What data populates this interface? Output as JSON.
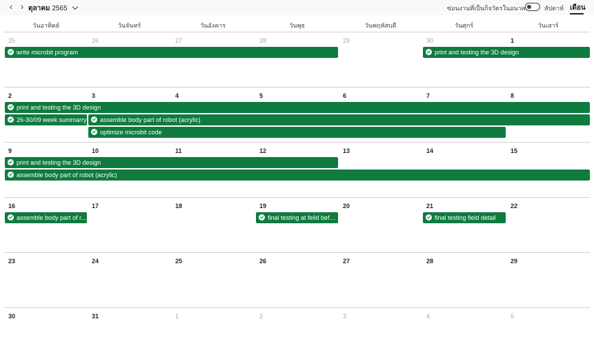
{
  "header": {
    "prev_icon": "chevron-left-icon",
    "next_icon": "chevron-right-icon",
    "month": "ตุลาคม",
    "year": "2565",
    "dropdown_icon": "chevron-down-icon",
    "toggle_label": "ซ่อนงานที่เป็นกิจวัตรในอนาคต",
    "toggle_on": false,
    "view_week": "สัปดาห์",
    "view_month": "เดือน"
  },
  "weekdays": [
    "วันอาทิตย์",
    "วันจันทร์",
    "วันอังคาร",
    "วันพุธ",
    "วันพฤหัสบดี",
    "วันศุกร์",
    "วันเสาร์"
  ],
  "weeks": [
    {
      "dates": [
        {
          "d": "25",
          "muted": true
        },
        {
          "d": "26",
          "muted": true
        },
        {
          "d": "27",
          "muted": true
        },
        {
          "d": "28",
          "muted": true
        },
        {
          "d": "29",
          "muted": true
        },
        {
          "d": "30",
          "muted": true
        },
        {
          "d": "1",
          "muted": false
        }
      ],
      "events": [
        {
          "title": "write microbit program",
          "start": 0,
          "span": 4,
          "slot": 0
        },
        {
          "title": "print and testing the 3D design",
          "start": 5,
          "span": 2,
          "slot": 0
        }
      ]
    },
    {
      "dates": [
        {
          "d": "2",
          "muted": false
        },
        {
          "d": "3",
          "muted": false
        },
        {
          "d": "4",
          "muted": false
        },
        {
          "d": "5",
          "muted": false
        },
        {
          "d": "6",
          "muted": false
        },
        {
          "d": "7",
          "muted": false
        },
        {
          "d": "8",
          "muted": false
        }
      ],
      "events": [
        {
          "title": "print and testing the 3D design",
          "start": 0,
          "span": 7,
          "slot": 0
        },
        {
          "title": "26-30/09 week summarry",
          "start": 0,
          "span": 1,
          "slot": 1
        },
        {
          "title": "assemble body part of robot (acrylic)",
          "start": 1,
          "span": 6,
          "slot": 1
        },
        {
          "title": "optimize microbit code",
          "start": 1,
          "span": 5,
          "slot": 2
        }
      ]
    },
    {
      "dates": [
        {
          "d": "9",
          "muted": false
        },
        {
          "d": "10",
          "muted": false
        },
        {
          "d": "11",
          "muted": false
        },
        {
          "d": "12",
          "muted": false
        },
        {
          "d": "13",
          "muted": false
        },
        {
          "d": "14",
          "muted": false
        },
        {
          "d": "15",
          "muted": false
        }
      ],
      "events": [
        {
          "title": "print and testing the 3D design",
          "start": 0,
          "span": 4,
          "slot": 0
        },
        {
          "title": "assemble body part of robot (acrylic)",
          "start": 0,
          "span": 7,
          "slot": 1
        }
      ]
    },
    {
      "dates": [
        {
          "d": "16",
          "muted": false
        },
        {
          "d": "17",
          "muted": false
        },
        {
          "d": "18",
          "muted": false
        },
        {
          "d": "19",
          "muted": false
        },
        {
          "d": "20",
          "muted": false
        },
        {
          "d": "21",
          "muted": false
        },
        {
          "d": "22",
          "muted": false
        }
      ],
      "events": [
        {
          "title": "assemble body part of r...",
          "start": 0,
          "span": 1,
          "slot": 0
        },
        {
          "title": "final testing at feild befo...",
          "start": 3,
          "span": 1,
          "slot": 0
        },
        {
          "title": "final testing field detail",
          "start": 5,
          "span": 1,
          "slot": 0
        }
      ]
    },
    {
      "dates": [
        {
          "d": "23",
          "muted": false
        },
        {
          "d": "24",
          "muted": false
        },
        {
          "d": "25",
          "muted": false
        },
        {
          "d": "26",
          "muted": false
        },
        {
          "d": "27",
          "muted": false
        },
        {
          "d": "28",
          "muted": false
        },
        {
          "d": "29",
          "muted": false
        }
      ],
      "events": []
    },
    {
      "dates": [
        {
          "d": "30",
          "muted": false
        },
        {
          "d": "31",
          "muted": false
        },
        {
          "d": "1",
          "muted": true
        },
        {
          "d": "2",
          "muted": true
        },
        {
          "d": "3",
          "muted": true
        },
        {
          "d": "4",
          "muted": true
        },
        {
          "d": "5",
          "muted": true
        }
      ],
      "events": []
    }
  ],
  "colors": {
    "event": "#0f7b3f",
    "text": "#242424",
    "muted": "#a8a8a8",
    "grid": "#d1d1d1"
  }
}
